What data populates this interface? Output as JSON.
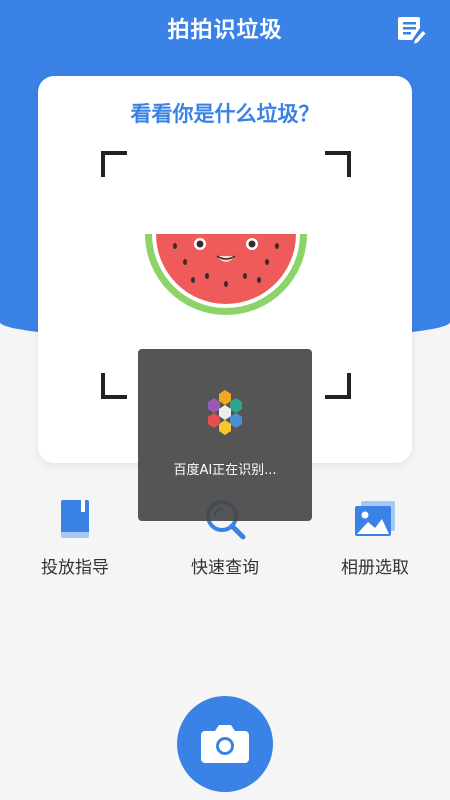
{
  "header": {
    "title": "拍拍识垃圾",
    "history_icon": "notes-edit-icon"
  },
  "scan_card": {
    "prompt": "看看你是什么垃圾？",
    "sample_image": "watermelon-slice"
  },
  "toast": {
    "message": "百度AI正在识别...",
    "icon": "baidu-ai-hexagon-icon"
  },
  "actions": [
    {
      "label": "投放指导",
      "icon": "book-icon"
    },
    {
      "label": "快速查询",
      "icon": "search-icon"
    },
    {
      "label": "相册选取",
      "icon": "gallery-icon"
    }
  ],
  "camera": {
    "icon": "camera-icon"
  },
  "colors": {
    "brand_blue": "#3b82e6",
    "background": "#f5f5f5",
    "toast_bg": "#464646"
  }
}
